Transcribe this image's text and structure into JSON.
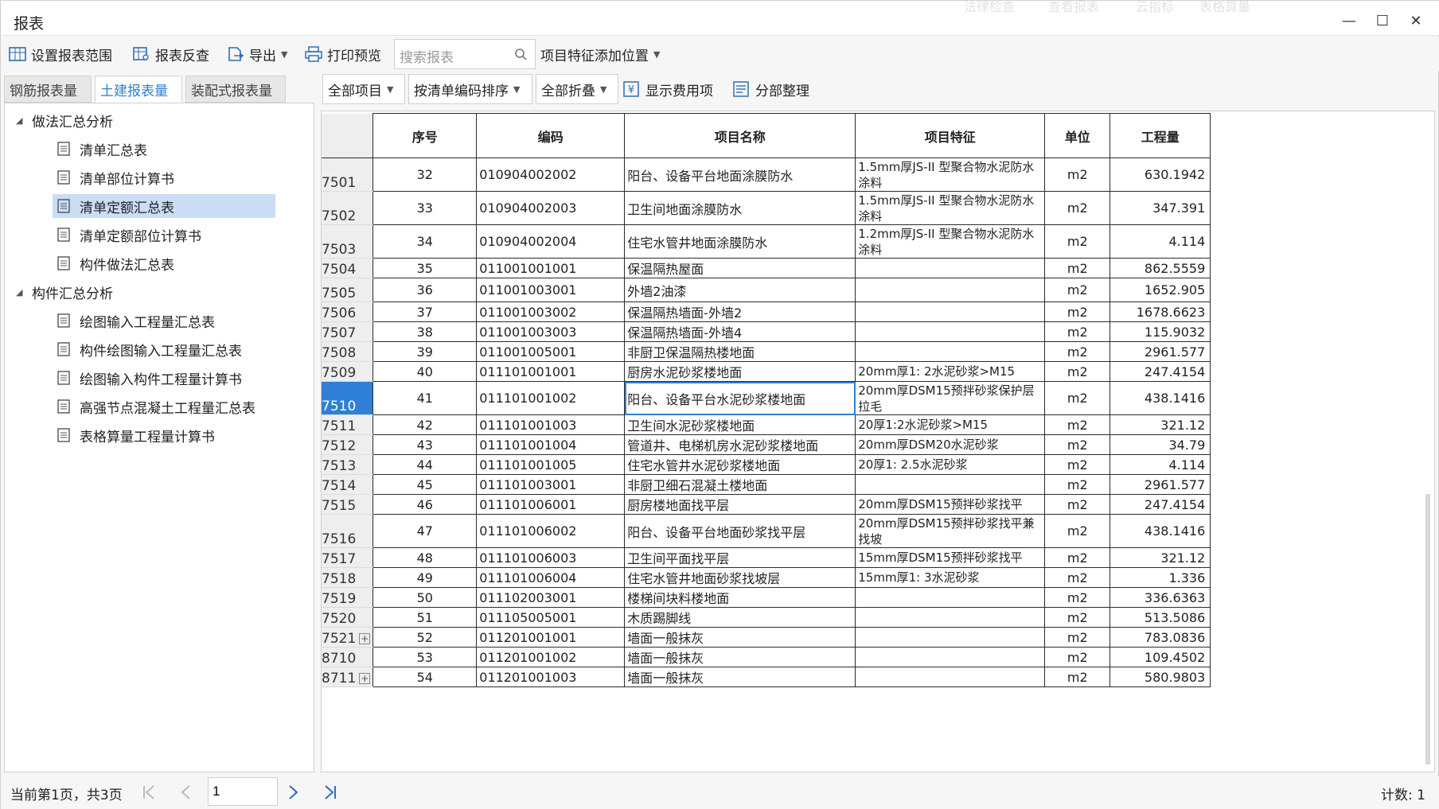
{
  "window": {
    "title": "报表",
    "ghost_tabs": [
      "法律检查",
      "查看报表",
      "云指标",
      "表格算量"
    ]
  },
  "toolbar": {
    "set_range": "设置报表范围",
    "report_check": "报表反查",
    "export": "导出",
    "print_preview": "打印预览",
    "search_placeholder": "搜索报表",
    "feature_position": "项目特征添加位置"
  },
  "left_tabs": [
    "钢筋报表量",
    "土建报表量",
    "装配式报表量"
  ],
  "tree": {
    "group1": "做法汇总分析",
    "group1_items": [
      "清单汇总表",
      "清单部位计算书",
      "清单定额汇总表",
      "清单定额部位计算书",
      "构件做法汇总表"
    ],
    "group2": "构件汇总分析",
    "group2_items": [
      "绘图输入工程量汇总表",
      "构件绘图输入工程量汇总表",
      "绘图输入构件工程量计算书",
      "高强节点混凝土工程量汇总表",
      "表格算量工程量计算书"
    ]
  },
  "right_toolbar": {
    "scope": "全部项目",
    "sort": "按清单编码排序",
    "fold": "全部折叠",
    "show_fee": "显示费用项",
    "organize": "分部整理"
  },
  "table": {
    "headers": [
      "序号",
      "编码",
      "项目名称",
      "项目特征",
      "单位",
      "工程量"
    ],
    "rows": [
      {
        "rn": "7501",
        "no": "32",
        "code": "010904002002",
        "name": "阳台、设备平台地面涂膜防水",
        "feat": "1.5mm厚JS-II 型聚合物水泥防水涂料",
        "unit": "m2",
        "qty": "630.1942"
      },
      {
        "rn": "7502",
        "no": "33",
        "code": "010904002003",
        "name": "卫生间地面涂膜防水",
        "feat": "1.5mm厚JS-II 型聚合物水泥防水涂料",
        "unit": "m2",
        "qty": "347.391"
      },
      {
        "rn": "7503",
        "no": "34",
        "code": "010904002004",
        "name": "住宅水管井地面涂膜防水",
        "feat": "1.2mm厚JS-II 型聚合物水泥防水涂料",
        "unit": "m2",
        "qty": "4.114"
      },
      {
        "rn": "7504",
        "no": "35",
        "code": "011001001001",
        "name": "保温隔热屋面",
        "feat": "",
        "unit": "m2",
        "qty": "862.5559"
      },
      {
        "rn": "7505",
        "no": "36",
        "code": "011001003001",
        "name": "外墙2油漆",
        "feat": "",
        "unit": "m2",
        "qty": "1652.905"
      },
      {
        "rn": "7506",
        "no": "37",
        "code": "011001003002",
        "name": "保温隔热墙面-外墙2",
        "feat": "",
        "unit": "m2",
        "qty": "1678.6623"
      },
      {
        "rn": "7507",
        "no": "38",
        "code": "011001003003",
        "name": "保温隔热墙面-外墙4",
        "feat": "",
        "unit": "m2",
        "qty": "115.9032"
      },
      {
        "rn": "7508",
        "no": "39",
        "code": "011001005001",
        "name": "非厨卫保温隔热楼地面",
        "feat": "",
        "unit": "m2",
        "qty": "2961.577"
      },
      {
        "rn": "7509",
        "no": "40",
        "code": "011101001001",
        "name": "厨房水泥砂浆楼地面",
        "feat": "20mm厚1: 2水泥砂浆>M15",
        "unit": "m2",
        "qty": "247.4154"
      },
      {
        "rn": "7510",
        "no": "41",
        "code": "011101001002",
        "name": "阳台、设备平台水泥砂浆楼地面",
        "feat": "20mm厚DSM15预拌砂浆保护层拉毛",
        "unit": "m2",
        "qty": "438.1416"
      },
      {
        "rn": "7511",
        "no": "42",
        "code": "011101001003",
        "name": "卫生间水泥砂浆楼地面",
        "feat": "20厚1:2水泥砂浆>M15",
        "unit": "m2",
        "qty": "321.12"
      },
      {
        "rn": "7512",
        "no": "43",
        "code": "011101001004",
        "name": "管道井、电梯机房水泥砂浆楼地面",
        "feat": "20mm厚DSM20水泥砂浆",
        "unit": "m2",
        "qty": "34.79"
      },
      {
        "rn": "7513",
        "no": "44",
        "code": "011101001005",
        "name": "住宅水管井水泥砂浆楼地面",
        "feat": "20厚1: 2.5水泥砂浆",
        "unit": "m2",
        "qty": "4.114"
      },
      {
        "rn": "7514",
        "no": "45",
        "code": "011101003001",
        "name": "非厨卫细石混凝土楼地面",
        "feat": "",
        "unit": "m2",
        "qty": "2961.577"
      },
      {
        "rn": "7515",
        "no": "46",
        "code": "011101006001",
        "name": "厨房楼地面找平层",
        "feat": "20mm厚DSM15预拌砂浆找平",
        "unit": "m2",
        "qty": "247.4154"
      },
      {
        "rn": "7516",
        "no": "47",
        "code": "011101006002",
        "name": "阳台、设备平台地面砂浆找平层",
        "feat": "20mm厚DSM15预拌砂浆找平兼找坡",
        "unit": "m2",
        "qty": "438.1416"
      },
      {
        "rn": "7517",
        "no": "48",
        "code": "011101006003",
        "name": "卫生间平面找平层",
        "feat": "15mm厚DSM15预拌砂浆找平",
        "unit": "m2",
        "qty": "321.12"
      },
      {
        "rn": "7518",
        "no": "49",
        "code": "011101006004",
        "name": "住宅水管井地面砂浆找坡层",
        "feat": "15mm厚1: 3水泥砂浆",
        "unit": "m2",
        "qty": "1.336"
      },
      {
        "rn": "7519",
        "no": "50",
        "code": "011102003001",
        "name": "楼梯间块料楼地面",
        "feat": "",
        "unit": "m2",
        "qty": "336.6363"
      },
      {
        "rn": "7520",
        "no": "51",
        "code": "011105005001",
        "name": "木质踢脚线",
        "feat": "",
        "unit": "m2",
        "qty": "513.5086"
      },
      {
        "rn": "7521",
        "no": "52",
        "code": "011201001001",
        "name": "墙面一般抹灰",
        "feat": "",
        "unit": "m2",
        "qty": "783.0836",
        "plus": true
      },
      {
        "rn": "8710",
        "no": "53",
        "code": "011201001002",
        "name": "墙面一般抹灰",
        "feat": "",
        "unit": "m2",
        "qty": "109.4502"
      },
      {
        "rn": "8711",
        "no": "54",
        "code": "011201001003",
        "name": "墙面一般抹灰",
        "feat": "",
        "unit": "m2",
        "qty": "580.9803",
        "plus": true
      }
    ]
  },
  "status": {
    "page_info": "当前第1页，共3页",
    "page_value": "1",
    "count": "计数: 1"
  },
  "colors": {
    "accent": "#2f7fd6",
    "selected_tree": "#c9ddf5"
  }
}
